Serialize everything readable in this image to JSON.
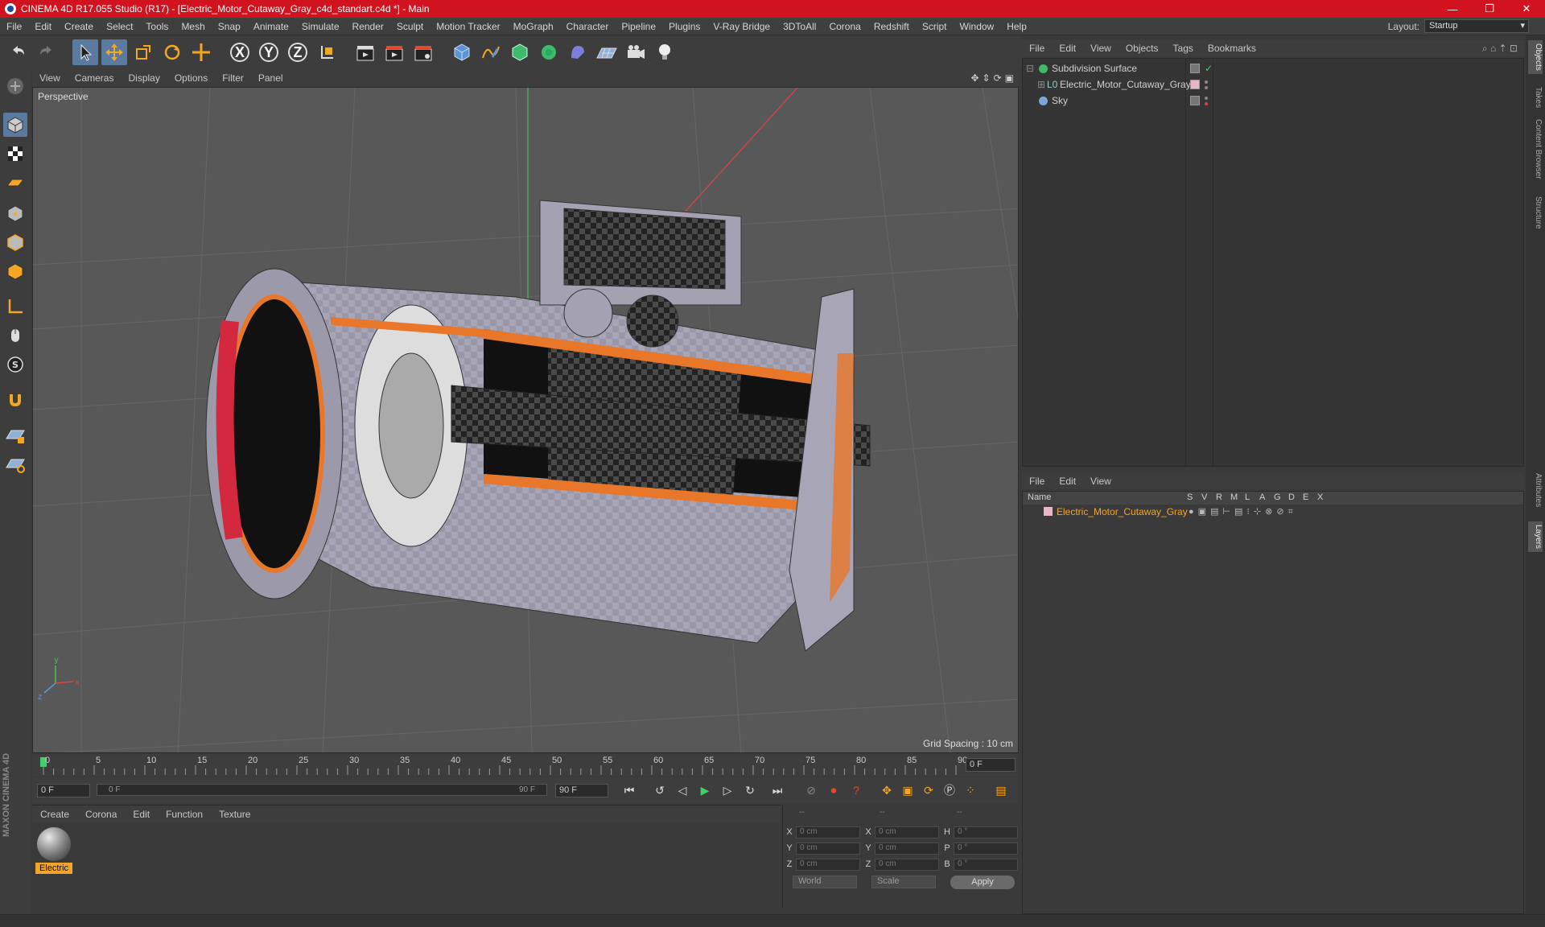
{
  "window": {
    "title": "CINEMA 4D R17.055 Studio (R17) - [Electric_Motor_Cutaway_Gray_c4d_standart.c4d *] - Main",
    "controls": {
      "minimize": "—",
      "maximize": "❐",
      "close": "✕"
    }
  },
  "menubar": {
    "items": [
      "File",
      "Edit",
      "Create",
      "Select",
      "Tools",
      "Mesh",
      "Snap",
      "Animate",
      "Simulate",
      "Render",
      "Sculpt",
      "Motion Tracker",
      "MoGraph",
      "Character",
      "Pipeline",
      "Plugins",
      "V-Ray Bridge",
      "3DToAll",
      "Corona",
      "Redshift",
      "Script",
      "Window",
      "Help"
    ],
    "layout_label": "Layout:",
    "layout_value": "Startup"
  },
  "toolbar": {
    "axis_x": "X",
    "axis_y": "Y",
    "axis_z": "Z"
  },
  "viewport": {
    "menu": [
      "View",
      "Cameras",
      "Display",
      "Options",
      "Filter",
      "Panel"
    ],
    "label": "Perspective",
    "grid_spacing": "Grid Spacing : 10 cm",
    "axis_x": "x",
    "axis_y": "y",
    "axis_z": "z"
  },
  "timeline": {
    "ticks": [
      "0",
      "5",
      "10",
      "15",
      "20",
      "25",
      "30",
      "35",
      "40",
      "45",
      "50",
      "55",
      "60",
      "65",
      "70",
      "75",
      "80",
      "85",
      "90"
    ],
    "current_frame": "0 F",
    "start_frame": "0 F",
    "slider_start": "0 F",
    "slider_end": "90 F",
    "end_frame": "90 F"
  },
  "material_manager": {
    "menu": [
      "Create",
      "Corona",
      "Edit",
      "Function",
      "Texture"
    ],
    "materials": [
      {
        "label": "Electric"
      }
    ]
  },
  "coordinates": {
    "header": [
      "--",
      "--",
      "--"
    ],
    "rows": [
      {
        "a": "X",
        "av": "0 cm",
        "b": "X",
        "bv": "0 cm",
        "c": "H",
        "cv": "0 °"
      },
      {
        "a": "Y",
        "av": "0 cm",
        "b": "Y",
        "bv": "0 cm",
        "c": "P",
        "cv": "0 °"
      },
      {
        "a": "Z",
        "av": "0 cm",
        "b": "Z",
        "bv": "0 cm",
        "c": "B",
        "cv": "0 °"
      }
    ],
    "world": "World",
    "scale": "Scale",
    "apply": "Apply"
  },
  "object_manager": {
    "menu": [
      "File",
      "Edit",
      "View",
      "Objects",
      "Tags",
      "Bookmarks"
    ],
    "objects": [
      {
        "name": "Subdivision Surface",
        "color": "#3fb96a"
      },
      {
        "name": "Electric_Motor_Cutaway_Gray",
        "color": "#6fa0d0"
      },
      {
        "name": "Sky",
        "color": "#7aa7d8"
      }
    ]
  },
  "layer_manager": {
    "menu": [
      "File",
      "Edit",
      "View"
    ],
    "columns": [
      "Name",
      "S",
      "V",
      "R",
      "M",
      "L",
      "A",
      "G",
      "D",
      "E",
      "X"
    ],
    "layers": [
      {
        "name": "Electric_Motor_Cutaway_Gray",
        "color": "#f2a52a"
      }
    ]
  },
  "side_tabs": [
    "Objects",
    "Takes",
    "Content Browser",
    "Structure",
    "Attributes",
    "Layers"
  ],
  "colors": {
    "accent": "#d0131e",
    "highlight": "#f2a52a",
    "selected": "#5a7aa0"
  }
}
